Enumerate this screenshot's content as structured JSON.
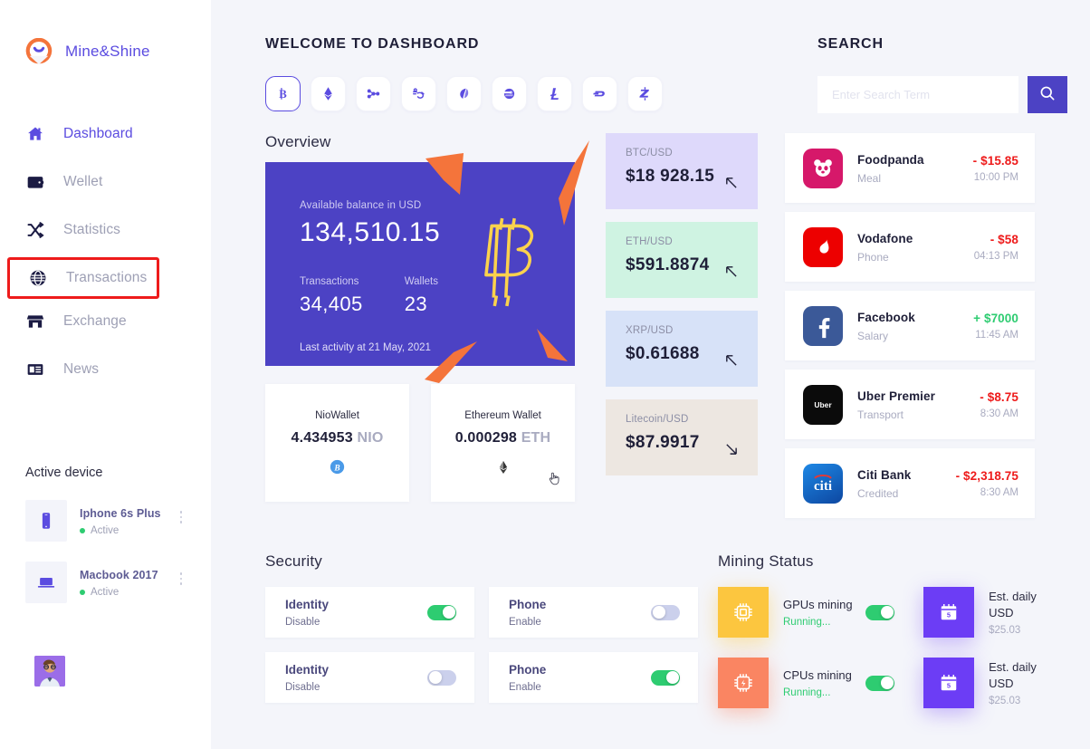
{
  "brand": {
    "name": "Mine&Shine",
    "logo_icon": "mineshine-logo-icon"
  },
  "sidebar": {
    "items": [
      {
        "label": "Dashboard",
        "icon": "home-icon",
        "active": true
      },
      {
        "label": "Wellet",
        "icon": "wallet-icon",
        "active": false
      },
      {
        "label": "Statistics",
        "icon": "shuffle-icon",
        "active": false
      },
      {
        "label": "Transactions",
        "icon": "globe-icon",
        "active": false,
        "highlighted": true
      },
      {
        "label": "Exchange",
        "icon": "store-icon",
        "active": false
      },
      {
        "label": "News",
        "icon": "news-icon",
        "active": false
      }
    ],
    "devices_title": "Active device",
    "devices": [
      {
        "name": "Iphone 6s Plus",
        "status": "Active",
        "icon": "phone-icon"
      },
      {
        "name": "Macbook 2017",
        "status": "Active",
        "icon": "laptop-icon"
      }
    ]
  },
  "header": {
    "welcome_title": "WELCOME TO DASHBOARD",
    "search_title": "SEARCH",
    "coins": [
      {
        "name": "bitcoin-icon",
        "symbol": "B",
        "selected": true
      },
      {
        "name": "ethereum-icon",
        "symbol": "E",
        "selected": false
      },
      {
        "name": "ripple-icon",
        "symbol": "X",
        "selected": false
      },
      {
        "name": "steem-icon",
        "symbol": "S",
        "selected": false
      },
      {
        "name": "neo-icon",
        "symbol": "N",
        "selected": false
      },
      {
        "name": "dash-circle-icon",
        "symbol": "D",
        "selected": false
      },
      {
        "name": "litecoin-icon",
        "symbol": "L",
        "selected": false
      },
      {
        "name": "dash-icon",
        "symbol": "D",
        "selected": false
      },
      {
        "name": "zcash-icon",
        "symbol": "Z",
        "selected": false
      }
    ]
  },
  "search": {
    "placeholder": "Enter Search Term",
    "value": "",
    "button_icon": "search-icon"
  },
  "overview": {
    "title": "Overview",
    "balance_label": "Available balance in USD",
    "balance_amount": "134,510.15",
    "transactions_label": "Transactions",
    "transactions_value": "34,405",
    "wallets_label": "Wallets",
    "wallets_value": "23",
    "last_activity": "Last activity at 21 May, 2021",
    "watermark_icon": "bitcoin-outline-icon"
  },
  "wallets": [
    {
      "name": "NioWallet",
      "amount": "4.434953",
      "unit": "NIO",
      "icon": "bitcoin-blue-icon"
    },
    {
      "name": "Ethereum Wallet",
      "amount": "0.000298",
      "unit": "ETH",
      "icon": "ethereum-dark-icon"
    }
  ],
  "prices": [
    {
      "pair": "BTC/USD",
      "value": "$18 928.15",
      "trend": "up",
      "bg": "#ded9fb"
    },
    {
      "pair": "ETH/USD",
      "value": "$591.8874",
      "trend": "up",
      "bg": "#cff3e2"
    },
    {
      "pair": "XRP/USD",
      "value": "$0.61688",
      "trend": "up",
      "bg": "#d7e2f8"
    },
    {
      "pair": "Litecoin/USD",
      "value": "$87.9917",
      "trend": "down",
      "bg": "#ede7e1"
    }
  ],
  "transactions": [
    {
      "name": "Foodpanda",
      "category": "Meal",
      "amount": "- $15.85",
      "sign": "neg",
      "time": "10:00 PM",
      "logo": "foodpanda-logo",
      "logo_bg": "#d6186a"
    },
    {
      "name": "Vodafone",
      "category": "Phone",
      "amount": "- $58",
      "sign": "neg",
      "time": "04:13 PM",
      "logo": "vodafone-logo",
      "logo_bg": "#ed0000"
    },
    {
      "name": "Facebook",
      "category": "Salary",
      "amount": "+ $7000",
      "sign": "pos",
      "time": "11:45 AM",
      "logo": "facebook-logo",
      "logo_bg": "#3b5998"
    },
    {
      "name": "Uber Premier",
      "category": "Transport",
      "amount": "- $8.75",
      "sign": "neg",
      "time": "8:30 AM",
      "logo": "uber-logo",
      "logo_bg": "#0b0b0b"
    },
    {
      "name": "Citi Bank",
      "category": "Credited",
      "amount": "- $2,318.75",
      "sign": "neg",
      "time": "8:30 AM",
      "logo": "citi-logo",
      "logo_bg": "#1565c0"
    }
  ],
  "security": {
    "title": "Security",
    "cards": [
      {
        "title": "Identity",
        "sub": "Disable",
        "on": true
      },
      {
        "title": "Phone",
        "sub": "Enable",
        "on": false
      },
      {
        "title": "Identity",
        "sub": "Disable",
        "on": false
      },
      {
        "title": "Phone",
        "sub": "Enable",
        "on": true
      }
    ]
  },
  "mining": {
    "title": "Mining Status",
    "rows": [
      {
        "chip": "gpu",
        "chip_icon": "cpu-bitcoin-icon",
        "name": "GPUs mining",
        "status": "Running...",
        "on": true,
        "cal_icon": "calendar-icon",
        "est_label": "Est. daily USD",
        "est_value": "$25.03"
      },
      {
        "chip": "cpu",
        "chip_icon": "cpu-bolt-icon",
        "name": "CPUs mining",
        "status": "Running...",
        "on": true,
        "cal_icon": "calendar-icon",
        "est_label": "Est. daily USD",
        "est_value": "$25.03"
      }
    ]
  },
  "colors": {
    "accent": "#4c42c4",
    "accent_light": "#5b4ce0",
    "green": "#2ecc71",
    "red": "#ee1b1b",
    "highlight_box": "#ee1b1b",
    "bg": "#f4f5fa"
  }
}
